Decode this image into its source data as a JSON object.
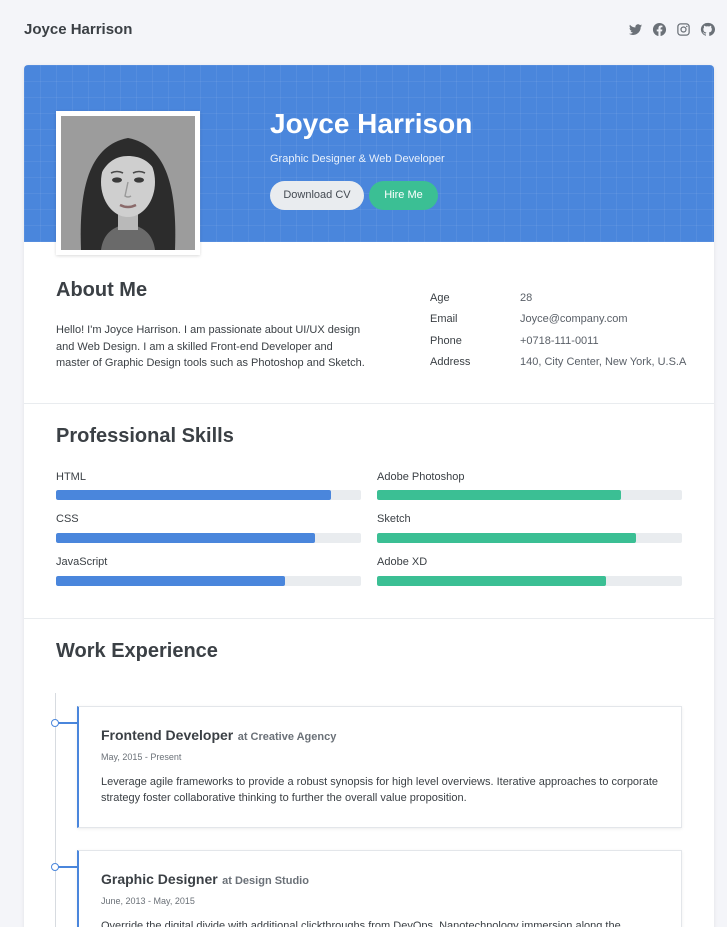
{
  "header": {
    "brand": "Joyce Harrison",
    "social_icons": [
      "twitter-icon",
      "facebook-icon",
      "instagram-icon",
      "github-icon"
    ]
  },
  "hero": {
    "name": "Joyce Harrison",
    "title": "Graphic Designer & Web Developer",
    "download_label": "Download CV",
    "hire_label": "Hire Me",
    "colors": {
      "background": "#4a86dc",
      "hire_button": "#3bbf94"
    }
  },
  "about": {
    "heading": "About Me",
    "text": "Hello! I'm Joyce Harrison. I am passionate about UI/UX design and Web Design. I am a skilled Front-end Developer and master of Graphic Design tools such as Photoshop and Sketch.",
    "info": [
      {
        "label": "Age",
        "value": "28"
      },
      {
        "label": "Email",
        "value": "Joyce@company.com"
      },
      {
        "label": "Phone",
        "value": "+0718-111-0011"
      },
      {
        "label": "Address",
        "value": "140, City Center, New York, U.S.A"
      }
    ]
  },
  "skills": {
    "heading": "Professional Skills",
    "left": [
      {
        "name": "HTML",
        "level": 0.9
      },
      {
        "name": "CSS",
        "level": 0.85
      },
      {
        "name": "JavaScript",
        "level": 0.75
      }
    ],
    "right": [
      {
        "name": "Adobe Photoshop",
        "level": 0.8
      },
      {
        "name": "Sketch",
        "level": 0.85
      },
      {
        "name": "Adobe XD",
        "level": 0.75
      }
    ],
    "colors": {
      "left": "#4a86dc",
      "right": "#3bbf94",
      "track": "#e9ecef"
    }
  },
  "experience": {
    "heading": "Work Experience",
    "jobs": [
      {
        "role": "Frontend Developer",
        "company": "at Creative Agency",
        "dates": "May, 2015 - Present",
        "description": "Leverage agile frameworks to provide a robust synopsis for high level overviews. Iterative approaches to corporate strategy foster collaborative thinking to further the overall value proposition."
      },
      {
        "role": "Graphic Designer",
        "company": "at Design Studio",
        "dates": "June, 2013 - May, 2015",
        "description": "Override the digital divide with additional clickthroughs from DevOps. Nanotechnology immersion along the"
      }
    ]
  }
}
